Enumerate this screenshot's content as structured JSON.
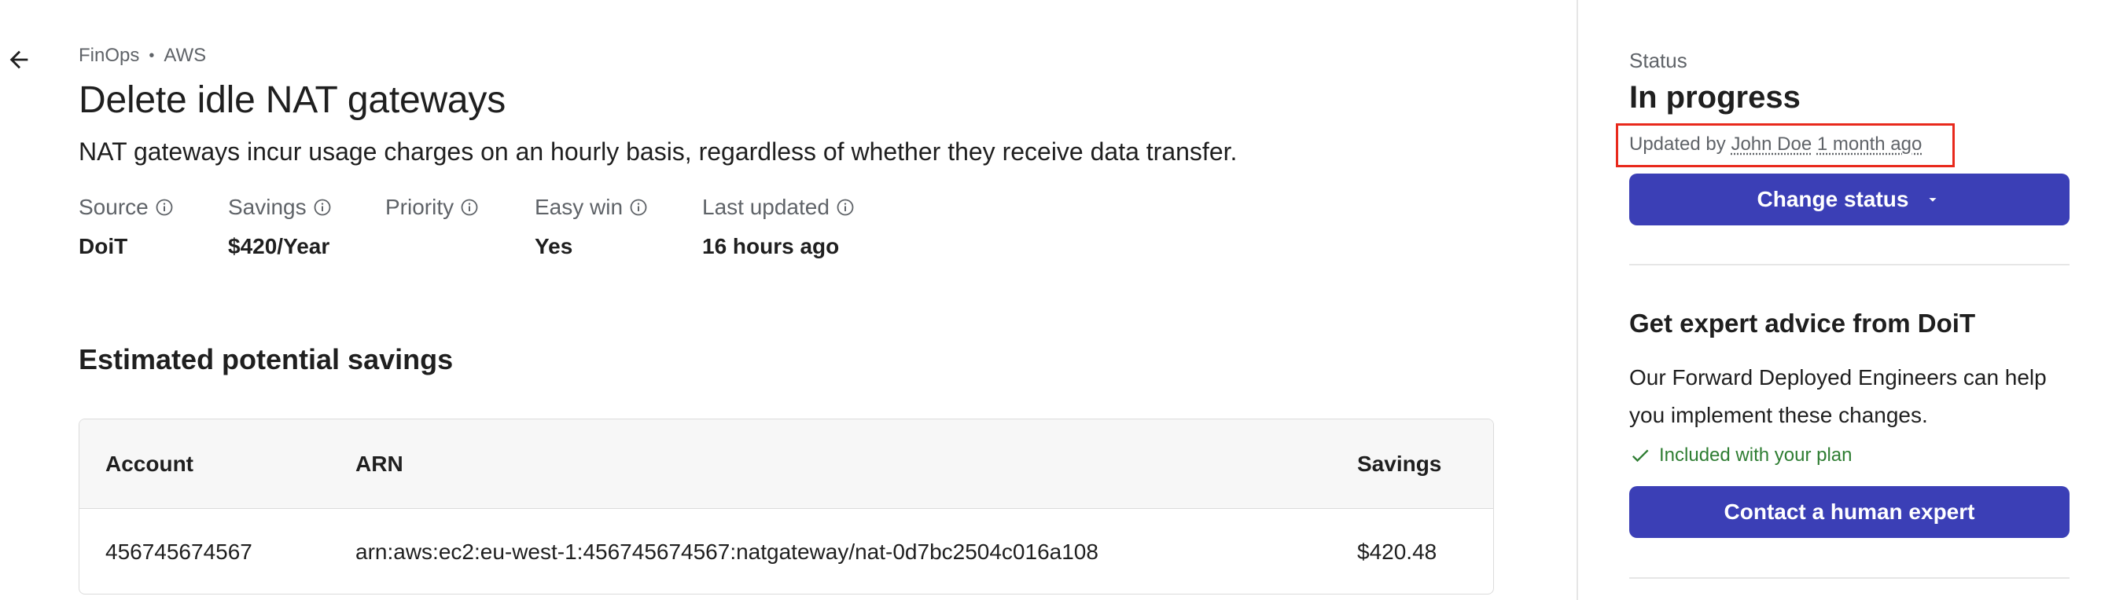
{
  "breadcrumb": {
    "items": [
      "FinOps",
      "AWS"
    ],
    "separator": "•"
  },
  "page": {
    "title": "Delete idle NAT gateways",
    "description": "NAT gateways incur usage charges on an hourly basis, regardless of whether they receive data transfer."
  },
  "meta": [
    {
      "label": "Source",
      "value": "DoiT"
    },
    {
      "label": "Savings",
      "value": "$420/Year"
    },
    {
      "label": "Priority",
      "value": ""
    },
    {
      "label": "Easy win",
      "value": "Yes"
    },
    {
      "label": "Last updated",
      "value": "16 hours ago"
    }
  ],
  "savings": {
    "title": "Estimated potential savings",
    "columns": [
      "Account",
      "ARN",
      "Savings"
    ],
    "rows": [
      {
        "account": "456745674567",
        "arn": "arn:aws:ec2:eu-west-1:456745674567:natgateway/nat-0d7bc2504c016a108",
        "savings": "$420.48"
      }
    ]
  },
  "status": {
    "label": "Status",
    "value": "In progress",
    "updated_prefix": "Updated by",
    "updated_user": "John Doe",
    "updated_time": "1 month ago",
    "button_label": "Change status"
  },
  "expert": {
    "title": "Get expert advice from DoiT",
    "body": "Our Forward Deployed Engineers can help you implement these changes.",
    "included": "Included with your plan",
    "button_label": "Contact a human expert"
  },
  "icons": {
    "back": "arrow-left-icon",
    "info": "info-icon",
    "dropdown": "caret-down-icon",
    "check": "check-icon"
  },
  "colors": {
    "primary": "#3b3fb6",
    "success": "#2e7d32",
    "highlight": "#e8291c",
    "muted": "#5f6368"
  }
}
